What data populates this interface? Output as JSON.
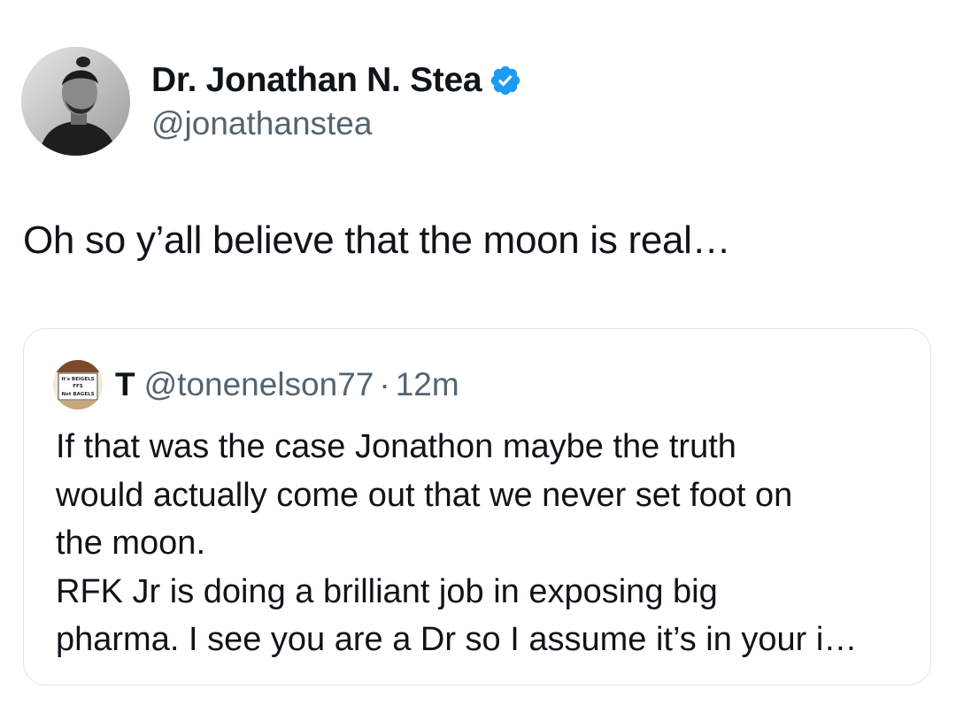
{
  "tweet": {
    "author": {
      "display_name": "Dr. Jonathan N. Stea",
      "handle": "@jonathanstea",
      "verified_icon": "verified-badge-icon",
      "verified_color": "#1d9bf0"
    },
    "text": "Oh so y’all believe that the moon is real…"
  },
  "quoted_tweet": {
    "author": {
      "display_name": "T",
      "handle": "@tonenelson77",
      "avatar_text": {
        "line1": "It's BEIGELS",
        "line2": "FFS",
        "line3": "Not BAGELS"
      }
    },
    "separator": "·",
    "timestamp": "12m",
    "lines": [
      "If that was the case Jonathon maybe the truth",
      "would actually come out that we never set foot on",
      "the moon.",
      "RFK Jr is doing a brilliant job in exposing big",
      "pharma. I see you are a Dr so I assume it’s in your i…"
    ]
  },
  "colors": {
    "text_primary": "#0f1419",
    "text_secondary": "#536471",
    "card_border": "#dfe4e8"
  }
}
